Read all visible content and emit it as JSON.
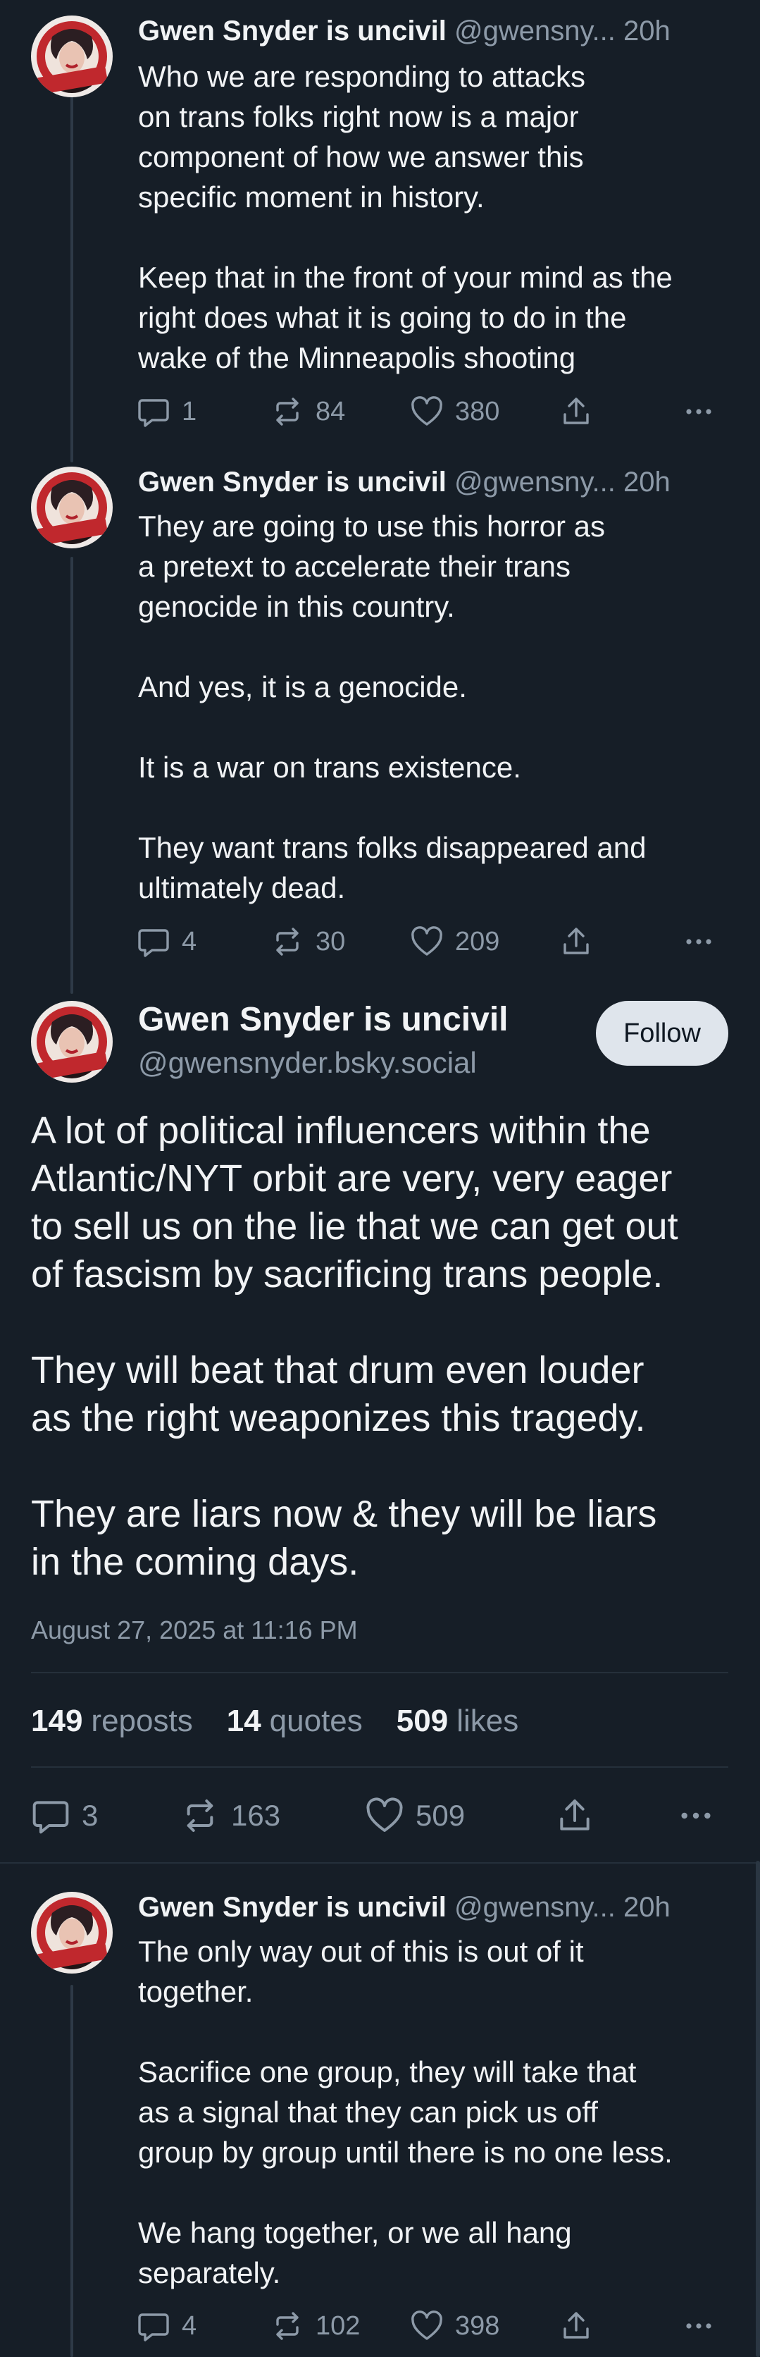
{
  "thread": [
    {
      "author_name": "Gwen Snyder is uncivil",
      "handle": "@gwensny...",
      "time": "20h",
      "text": "Who we are responding to attacks\non trans folks right now is a major\ncomponent of how we answer this\nspecific moment in history.\n\nKeep that in the front of your mind as the\nright does what it is going to do in the\nwake of the Minneapolis shooting",
      "replies": "1",
      "reposts": "84",
      "likes": "380"
    },
    {
      "author_name": "Gwen Snyder is uncivil",
      "handle": "@gwensny...",
      "time": "20h",
      "text": "They are going to use this horror as\na pretext to accelerate their trans\ngenocide in this country.\n\nAnd yes, it is a genocide.\n\nIt is a war on trans existence.\n\nThey want trans folks disappeared and\nultimately dead.",
      "replies": "4",
      "reposts": "30",
      "likes": "209"
    }
  ],
  "main_post": {
    "author_name": "Gwen Snyder is uncivil",
    "handle": "@gwensnyder.bsky.social",
    "follow_label": "Follow",
    "text": "A lot of political influencers within the\nAtlantic/NYT orbit are very, very eager\nto sell us on the lie that we can get out\nof fascism by sacrificing trans people.\n\nThey will beat that drum even louder\nas the right weaponizes this tragedy.\n\nThey are liars now & they will be liars\nin the coming days.",
    "date": "August 27, 2025 at 11:16 PM",
    "stats": {
      "reposts_count": "149",
      "reposts_label": "reposts",
      "quotes_count": "14",
      "quotes_label": "quotes",
      "likes_count": "509",
      "likes_label": "likes"
    },
    "replies": "3",
    "reposts": "163",
    "likes": "509"
  },
  "replies": [
    {
      "author_name": "Gwen Snyder is uncivil",
      "handle": "@gwensny...",
      "time": "20h",
      "text": "The only way out of this is out of it\ntogether.\n\nSacrifice one group, they will take that\nas a signal that they can pick us off\ngroup by group until there is no one less.\n\nWe hang together, or we all hang\nseparately.",
      "replies": "4",
      "reposts": "102",
      "likes": "398"
    }
  ],
  "icons": {
    "reply": "speech-bubble-icon",
    "repost": "repost-arrows-icon",
    "like": "heart-icon",
    "share": "share-upload-icon",
    "more": "more-ellipsis-icon"
  },
  "colors": {
    "background": "#161e27",
    "text_primary": "#f1f3f5",
    "text_secondary": "#8d9aa8",
    "follow_button_bg": "#dfe5ec"
  }
}
